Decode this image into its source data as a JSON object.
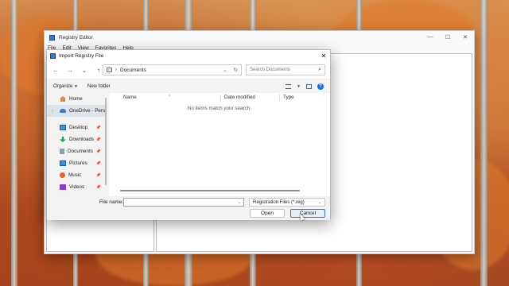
{
  "registry_editor": {
    "title": "Registry Editor",
    "menu": [
      "File",
      "Edit",
      "View",
      "Favorites",
      "Help"
    ],
    "window_controls": [
      "—",
      "☐",
      "✕"
    ]
  },
  "dialog": {
    "title": "Import Registry File",
    "close": "✕",
    "address": {
      "chevron": "›",
      "location": "Documents",
      "dropdown": "⌄",
      "refresh": "↻"
    },
    "search_placeholder": "Search Documents",
    "toolbar": {
      "organize": "Organize",
      "new_folder": "New folder"
    },
    "nav_items": [
      {
        "label": "Home",
        "icon": "home-icon"
      },
      {
        "label": "OneDrive - Pers",
        "icon": "cloud-icon"
      },
      {
        "label": "Desktop",
        "icon": "desktop-icon"
      },
      {
        "label": "Downloads",
        "icon": "downloads-icon"
      },
      {
        "label": "Documents",
        "icon": "documents-icon"
      },
      {
        "label": "Pictures",
        "icon": "pictures-icon"
      },
      {
        "label": "Music",
        "icon": "music-icon"
      },
      {
        "label": "Videos",
        "icon": "videos-icon"
      }
    ],
    "columns": [
      "Name",
      "Date modified",
      "Type"
    ],
    "empty_message": "No items match your search.",
    "file_name_label": "File name:",
    "file_name_value": "",
    "file_type": "Registration Files (*.reg)",
    "open_label": "Open",
    "cancel_label": "Cancel"
  }
}
